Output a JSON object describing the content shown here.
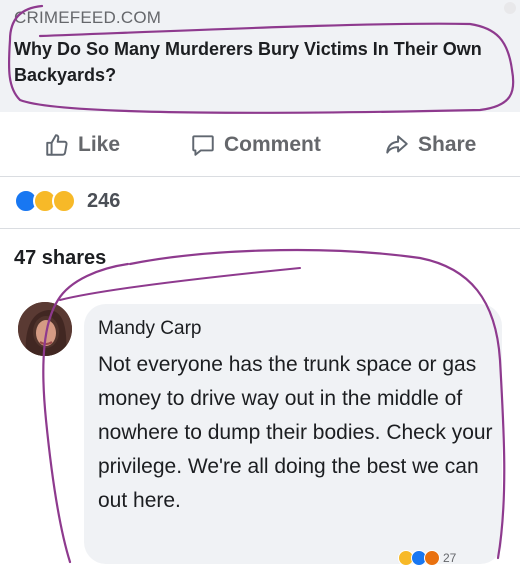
{
  "link": {
    "domain": "CRIMEFEED.COM",
    "title": "Why Do So Many Murderers Bury Victims In Their Own Backyards?"
  },
  "actions": {
    "like": "Like",
    "comment": "Comment",
    "share": "Share"
  },
  "reactions": {
    "count": "246",
    "types": [
      "like",
      "wow",
      "haha"
    ]
  },
  "shares": "47 shares",
  "comment": {
    "author": "Mandy Carp",
    "text": "Not everyone has the trunk space or gas money to drive way out in the middle of nowhere to dump their bodies. Check your privilege. We're all doing the best we can out here.",
    "reaction_count": "27"
  },
  "colors": {
    "scribble": "#8e3a8e",
    "like_blue": "#1877f2",
    "wow_yellow": "#f7b928",
    "angry_red": "#e9710f",
    "muted_text": "#65676b"
  },
  "icons": [
    "thumbs-up-icon",
    "comment-icon",
    "share-icon"
  ]
}
